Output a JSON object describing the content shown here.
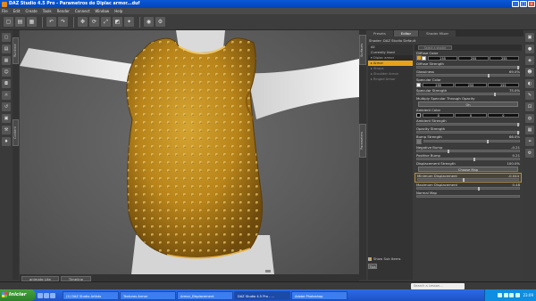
{
  "window": {
    "title": "DAZ Studio 4.5 Pro - Parametros do Diplac armor...duf",
    "controls": [
      "_",
      "□",
      "×"
    ]
  },
  "menu": [
    "File",
    "Edit",
    "Create",
    "Tools",
    "Render",
    "Connect",
    "Window",
    "Help"
  ],
  "viewport_tabs": [
    "Viewport",
    "Aux"
  ],
  "bottom_tabs": [
    "animate Lite",
    "Timeline"
  ],
  "left_vertical_tabs": [
    "Runtime",
    "Content"
  ],
  "right_vertical_tabs": [
    "Surfaces",
    "Parameters"
  ],
  "panel": {
    "tabs": [
      "Presets",
      "Editor",
      "Shader Mixer"
    ],
    "active_tab": "Editor",
    "shader_label": "Shader: DAZ Studio Default",
    "subbar_button": "Select a shader",
    "tree": [
      {
        "label": "All",
        "type": "item"
      },
      {
        "label": "Currently Used",
        "type": "item"
      },
      {
        "label": "▾ Diplac armor",
        "type": "head"
      },
      {
        "label": "▸ Armor",
        "type": "selected"
      },
      {
        "label": "▸ Straps",
        "type": "dim"
      },
      {
        "label": "▸ Shoulder Armor",
        "type": "dim"
      },
      {
        "label": "▸ Ringed Armor",
        "type": "dim"
      }
    ],
    "show_sub_items": "Show Sub Items",
    "bottom_button": "Tips",
    "properties": [
      {
        "name": "Diffuse Color",
        "kind": "color",
        "values": [
          "255",
          "255",
          "255"
        ],
        "textured": true
      },
      {
        "name": "Diffuse Strength",
        "kind": "slider",
        "value": ""
      },
      {
        "name": "Glossiness",
        "kind": "slider",
        "value": "69.0%"
      },
      {
        "name": "Specular Color",
        "kind": "color",
        "values": [
          "255",
          "255",
          "255"
        ],
        "textured": false
      },
      {
        "name": "Specular Strength",
        "kind": "slider",
        "value": "75.0%"
      },
      {
        "name": "Multiply Specular Through Opacity",
        "kind": "button",
        "value": "On"
      },
      {
        "name": "Ambient Color",
        "kind": "color",
        "values": [
          "0",
          "0",
          "0"
        ],
        "textured": false
      },
      {
        "name": "Ambient Strength",
        "kind": "slider",
        "value": ""
      },
      {
        "name": "Opacity Strength",
        "kind": "slider",
        "value": ""
      },
      {
        "name": "Bump Strength",
        "kind": "slider",
        "value": "66.0%",
        "textured": true
      },
      {
        "name": "Negative Bump",
        "kind": "slider",
        "value": "-0.21"
      },
      {
        "name": "Positive Bump",
        "kind": "slider",
        "value": "0.21"
      },
      {
        "name": "Displacement Strength",
        "kind": "slider",
        "value": "100.0%"
      },
      {
        "name": "",
        "kind": "button",
        "value": "Choose Map"
      },
      {
        "name": "Minimum Displacement",
        "kind": "slider",
        "value": "-0.044",
        "highlight": true
      },
      {
        "name": "Maximum Displacement",
        "kind": "slider",
        "value": "0.48"
      },
      {
        "name": "Normal Map",
        "kind": "slider",
        "value": ""
      }
    ]
  },
  "search_lessons_placeholder": "Search a Lesson...",
  "taskbar": {
    "start_label": "Iniciar",
    "tasks": [
      "(2) DAZ Studio Artists",
      "Texturas Armor",
      "Armor_Displacement",
      "DAZ Studio 4.5 Pro - ...",
      "Adobe Photoshop"
    ],
    "active_task": 3,
    "clock": "23:09"
  }
}
